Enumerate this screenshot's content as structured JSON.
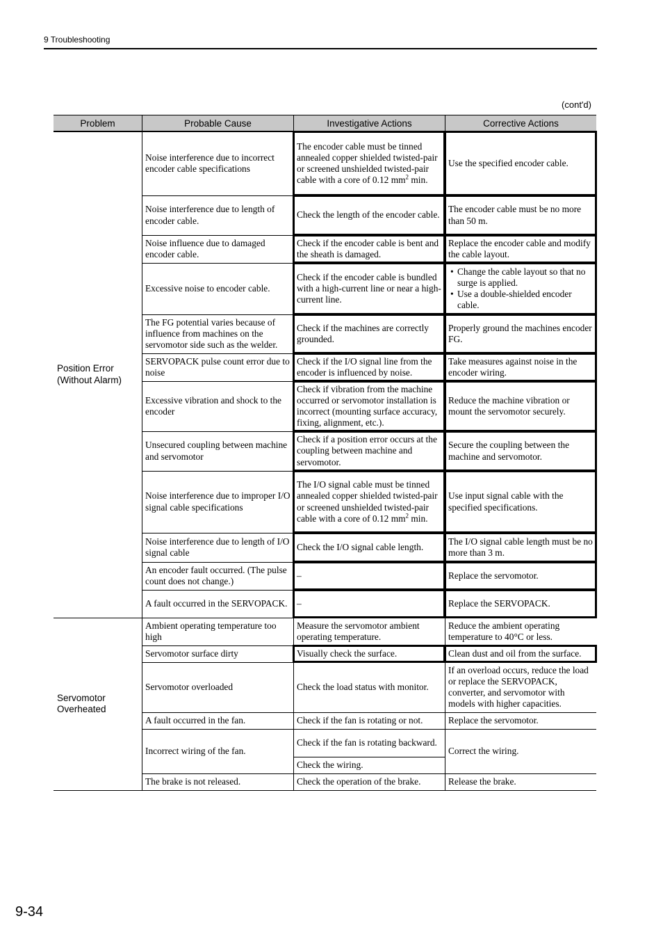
{
  "page_header": {
    "chapter": "9  Troubleshooting"
  },
  "contd_label": "(cont'd)",
  "page_number": "9-34",
  "table": {
    "headers": [
      "Problem",
      "Probable Cause",
      "Investigative Actions",
      "Corrective Actions"
    ],
    "groups": [
      {
        "problem": [
          "Position Error",
          "(Without Alarm)"
        ],
        "rows": [
          {
            "cause": "Noise interference due to incorrect encoder cable specifications",
            "investigate": "The encoder cable must be tinned annealed copper shielded twisted-pair or screened unshielded twisted-pair cable with a core of 0.12 mm",
            "investigate_sup": "2",
            "investigate_tail": " min.",
            "correct": "Use the specified encoder cable."
          },
          {
            "cause": "Noise interference due to length of encoder cable.",
            "investigate": "Check the length of the encoder cable.",
            "correct": "The encoder cable must be no more than 50 m."
          },
          {
            "cause": "Noise influence due to damaged encoder cable.",
            "investigate": "Check if the encoder cable is bent and the sheath is damaged.",
            "correct": "Replace the encoder cable and modify the cable layout."
          },
          {
            "cause": "Excessive noise to encoder cable.",
            "investigate": "Check if the encoder cable is bundled with a high-current line or near a high-current line.",
            "correct_bullets": [
              "Change the cable layout so that no surge is applied.",
              "Use a double-shielded encoder cable."
            ]
          },
          {
            "cause": "The FG potential varies because of influence from machines on the servomotor side such as the welder.",
            "investigate": "Check if the machines are correctly grounded.",
            "correct": "Properly ground the machines encoder FG."
          },
          {
            "cause": "SERVOPACK pulse count error due to noise",
            "investigate": "Check if the I/O signal line from the encoder is influenced by noise.",
            "correct": "Take measures against noise in the encoder wiring."
          },
          {
            "cause": "Excessive vibration and shock to the encoder",
            "investigate": "Check if vibration from the machine occurred or servomotor installation is incorrect (mounting surface accuracy, fixing, alignment, etc.).",
            "correct": "Reduce the machine vibration or mount the servomotor securely."
          },
          {
            "cause": "Unsecured coupling between machine and servomotor",
            "investigate": "Check if a position error occurs at the coupling between machine and servomotor.",
            "correct": "Secure the coupling between the machine and servomotor."
          },
          {
            "cause": "Noise interference due to improper I/O signal cable specifications",
            "investigate": "The I/O signal cable must be tinned annealed copper shielded twisted-pair or screened unshielded twisted-pair cable with a core of 0.12 mm",
            "investigate_sup": "2",
            "investigate_tail": " min.",
            "correct": "Use input signal cable with the specified specifications."
          },
          {
            "cause": "Noise interference due to length of I/O signal cable",
            "investigate": "Check the I/O signal cable length.",
            "correct": "The I/O signal cable length must be no more than 3 m."
          },
          {
            "cause": "An encoder fault occurred. (The pulse count does not change.)",
            "investigate": "–",
            "correct": "Replace the servomotor."
          },
          {
            "cause": "A fault occurred in the SERVOPACK.",
            "investigate": "–",
            "correct": "Replace the SERVOPACK."
          }
        ]
      },
      {
        "problem": [
          "Servomotor",
          "Overheated"
        ],
        "rows": [
          {
            "cause": "Ambient operating temperature too high",
            "investigate": "Measure the servomotor ambient operating temperature.",
            "correct": "Reduce the ambient operating temperature to 40°C or less."
          },
          {
            "cause": "Servomotor surface dirty",
            "investigate": "Visually check the surface.",
            "correct": "Clean dust and oil from the surface."
          },
          {
            "cause": "Servomotor overloaded",
            "investigate": "Check the load status with monitor.",
            "correct": "If an overload occurs, reduce the load or replace the SERVOPACK, converter, and servomotor with models with higher capacities."
          },
          {
            "cause": "A fault occurred in the fan.",
            "investigate": "Check if the fan is rotating or not.",
            "correct": "Replace the servomotor."
          },
          {
            "cause": "Incorrect wiring of the fan.",
            "investigate_multi": [
              "Check if the fan is rotating backward.",
              "Check the wiring."
            ],
            "correct": "Correct the wiring."
          },
          {
            "cause": "The brake is not released.",
            "investigate": "Check the operation of the brake.",
            "correct": "Release the brake."
          }
        ]
      }
    ]
  }
}
